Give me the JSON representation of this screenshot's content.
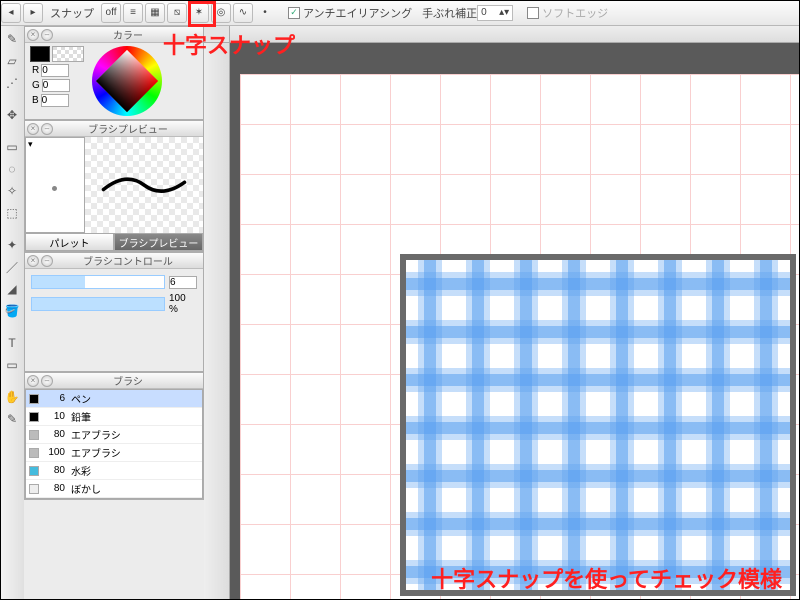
{
  "toolbar": {
    "snap_label": "スナップ",
    "off_label": "off",
    "antialias_label": "アンチエイリアシング",
    "stabilizer_label": "手ぶれ補正",
    "stabilizer_value": "0",
    "softedge_label": "ソフトエッジ",
    "antialias_checked": true,
    "softedge_checked": false
  },
  "panels": {
    "color": {
      "title": "カラー",
      "R": "0",
      "G": "0",
      "B": "0"
    },
    "preview": {
      "title": "ブラシプレビュー",
      "tab_palette": "パレット",
      "tab_preview": "ブラシプレビュー"
    },
    "control": {
      "title": "ブラシコントロール",
      "size_value": "6",
      "opacity_value": "100 %"
    },
    "brush": {
      "title": "ブラシ",
      "items": [
        {
          "size": "6",
          "name": "ペン",
          "sel": true,
          "color": "#000"
        },
        {
          "size": "10",
          "name": "鉛筆",
          "sel": false,
          "color": "#000"
        },
        {
          "size": "80",
          "name": "エアブラシ",
          "sel": false,
          "color": "#bbb"
        },
        {
          "size": "100",
          "name": "エアブラシ",
          "sel": false,
          "color": "#bbb"
        },
        {
          "size": "80",
          "name": "水彩",
          "sel": false,
          "color": "#4bd"
        },
        {
          "size": "80",
          "name": "ぼかし",
          "sel": false,
          "color": "#eee"
        }
      ]
    }
  },
  "annotations": {
    "title": "十字スナップ",
    "caption": "十字スナップを使ってチェック模様"
  },
  "rgb_labels": {
    "R": "R",
    "G": "G",
    "B": "B"
  }
}
